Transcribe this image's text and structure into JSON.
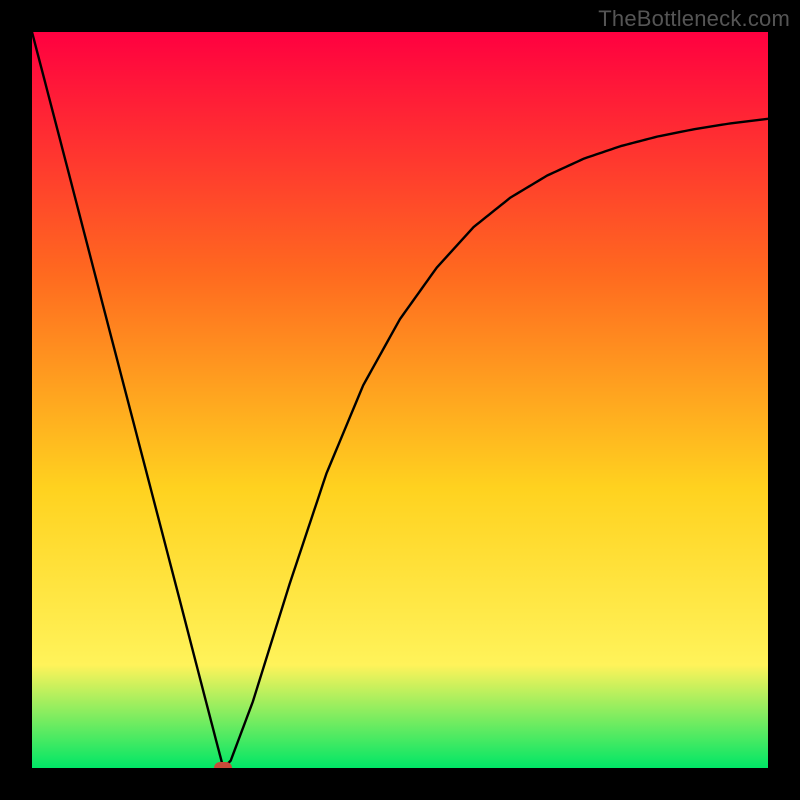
{
  "watermark": "TheBottleneck.com",
  "colors": {
    "frame": "#000000",
    "gradient_top": "#ff0040",
    "gradient_mid1": "#ff6a1f",
    "gradient_mid2": "#ffd21f",
    "gradient_mid3": "#fff35a",
    "gradient_bottom": "#00e666",
    "curve": "#000000",
    "marker": "#c84b3a"
  },
  "chart_data": {
    "type": "line",
    "title": "",
    "xlabel": "",
    "ylabel": "",
    "xlim": [
      0,
      100
    ],
    "ylim": [
      0,
      100
    ],
    "grid": false,
    "x": [
      0,
      5,
      10,
      15,
      20,
      23,
      25,
      26,
      27,
      30,
      35,
      40,
      45,
      50,
      55,
      60,
      65,
      70,
      75,
      80,
      85,
      90,
      95,
      100
    ],
    "values": [
      100,
      80.8,
      61.5,
      42.3,
      23.1,
      11.5,
      3.8,
      0,
      1,
      9,
      25,
      40,
      52,
      61,
      68,
      73.5,
      77.5,
      80.5,
      82.8,
      84.5,
      85.8,
      86.8,
      87.6,
      88.2
    ],
    "marker": {
      "x": 26,
      "y": 0
    }
  }
}
